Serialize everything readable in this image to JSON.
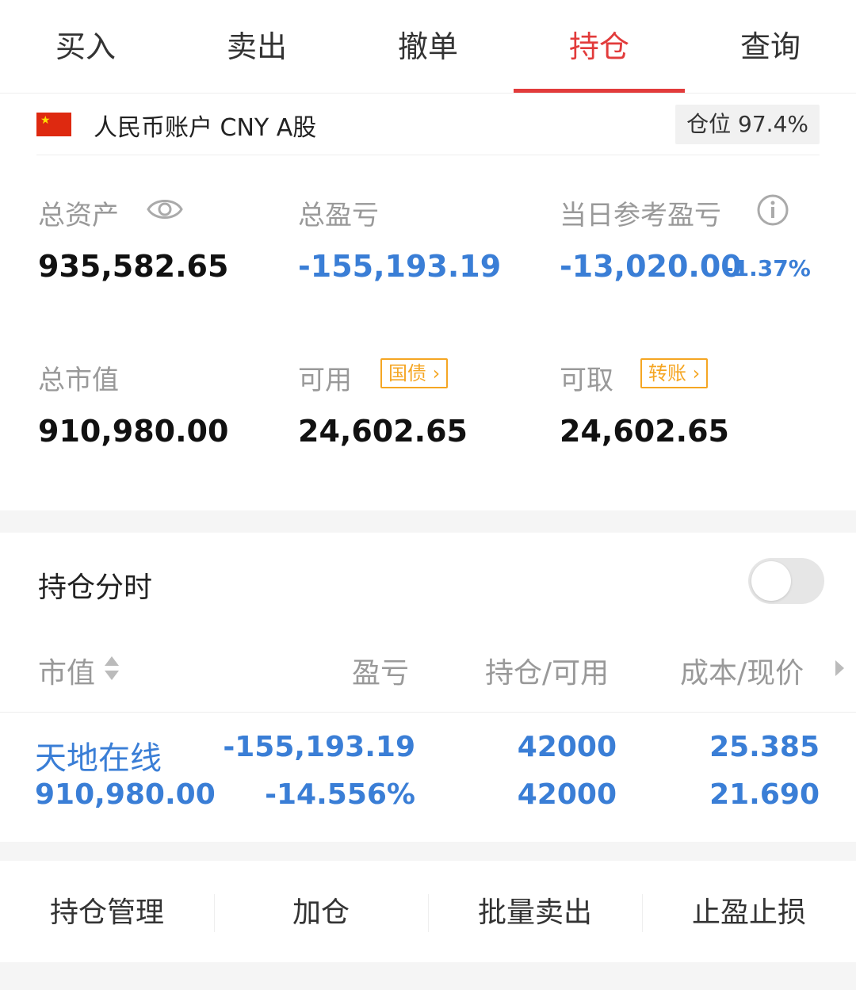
{
  "tabs": [
    {
      "label": "买入"
    },
    {
      "label": "卖出"
    },
    {
      "label": "撤单"
    },
    {
      "label": "持仓"
    },
    {
      "label": "查询"
    }
  ],
  "active_tab": "持仓",
  "account": {
    "name": "人民币账户 CNY A股",
    "position_ratio": "仓位 97.4%"
  },
  "stats": {
    "total_assets_label": "总资产",
    "total_assets_value": "935,582.65",
    "total_pnl_label": "总盈亏",
    "total_pnl_value": "-155,193.19",
    "daily_pnl_label": "当日参考盈亏",
    "daily_pnl_value": "-13,020.00",
    "daily_pnl_pct": "-1.37%",
    "market_value_label": "总市值",
    "market_value_value": "910,980.00",
    "available_label": "可用",
    "available_badge": "国债",
    "available_value": "24,602.65",
    "withdrawable_label": "可取",
    "withdrawable_badge": "转账",
    "withdrawable_value": "24,602.65"
  },
  "holding_time": {
    "label": "持仓分时",
    "enabled": false
  },
  "table": {
    "headers": {
      "market_value": "市值",
      "pnl": "盈亏",
      "position": "持仓/可用",
      "cost_price": "成本/现价"
    },
    "rows": [
      {
        "name": "天地在线",
        "market_value": "910,980.00",
        "pnl": "-155,193.19",
        "pnl_pct": "-14.556%",
        "position": "42000",
        "available": "42000",
        "cost": "25.385",
        "price": "21.690"
      }
    ]
  },
  "actions": [
    {
      "label": "持仓管理"
    },
    {
      "label": "加仓"
    },
    {
      "label": "批量卖出"
    },
    {
      "label": "止盈止损"
    }
  ],
  "colors": {
    "accent_red": "#e23b3b",
    "loss_blue": "#3a7ed6",
    "badge_orange": "#f5a623"
  }
}
